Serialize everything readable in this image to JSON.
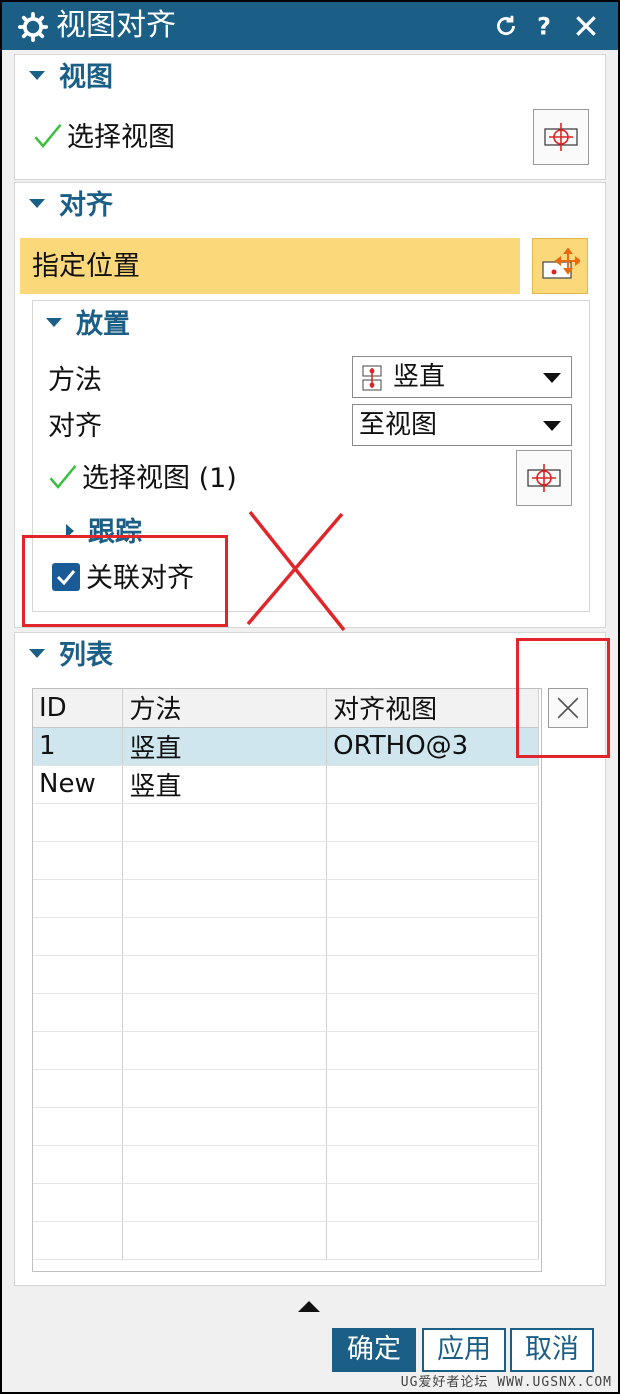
{
  "titlebar": {
    "title": "视图对齐",
    "icons": [
      "gear-icon",
      "reset-icon",
      "help-icon",
      "close-icon"
    ]
  },
  "view_group": {
    "header": "视图",
    "select_view_label": "选择视图"
  },
  "align_group": {
    "header": "对齐",
    "specify_location": "指定位置",
    "placement": {
      "header": "放置",
      "method_label": "方法",
      "method_value": "竖直",
      "align_label": "对齐",
      "align_value": "至视图",
      "select_view_label": "选择视图 (1)",
      "trace_header": "跟踪",
      "assoc_align_label": "关联对齐",
      "assoc_align_checked": true
    }
  },
  "list_group": {
    "header": "列表",
    "columns": [
      "ID",
      "方法",
      "对齐视图"
    ],
    "rows": [
      [
        "1",
        "竖直",
        "ORTHO@3"
      ],
      [
        "New",
        "竖直",
        ""
      ]
    ],
    "selected_row": 0
  },
  "buttons": {
    "ok": "确定",
    "apply": "应用",
    "cancel": "取消"
  },
  "watermark": "UG爱好者论坛 WWW.UGSNX.COM",
  "colors": {
    "titlebar": "#1c5f86",
    "highlight": "#fbd97a",
    "annotation": "#e0262b"
  }
}
